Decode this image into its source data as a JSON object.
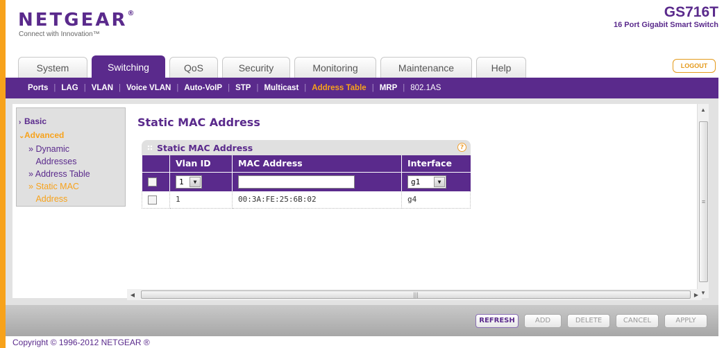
{
  "header": {
    "logo": "NETGEAR",
    "logo_mark": "®",
    "tagline": "Connect with Innovation™",
    "model": "GS716T",
    "model_description": "16 Port Gigabit Smart Switch",
    "logout_label": "LOGOUT"
  },
  "tabs": [
    {
      "label": "System",
      "active": false
    },
    {
      "label": "Switching",
      "active": true
    },
    {
      "label": "QoS",
      "active": false
    },
    {
      "label": "Security",
      "active": false
    },
    {
      "label": "Monitoring",
      "active": false
    },
    {
      "label": "Maintenance",
      "active": false
    },
    {
      "label": "Help",
      "active": false
    }
  ],
  "subnav": [
    {
      "label": "Ports",
      "active": false
    },
    {
      "label": "LAG",
      "active": false
    },
    {
      "label": "VLAN",
      "active": false
    },
    {
      "label": "Voice VLAN",
      "active": false
    },
    {
      "label": "Auto-VoIP",
      "active": false
    },
    {
      "label": "STP",
      "active": false
    },
    {
      "label": "Multicast",
      "active": false
    },
    {
      "label": "Address Table",
      "active": true
    },
    {
      "label": "MRP",
      "active": false
    },
    {
      "label": "802.1AS",
      "active": false
    }
  ],
  "leftnav": {
    "basic": "Basic",
    "advanced": "Advanced",
    "dynamic_addresses": "Dynamic Addresses",
    "address_table": "Address Table",
    "static_mac_address": "Static MAC Address"
  },
  "main": {
    "page_title": "Static MAC Address",
    "panel_title": "Static MAC Address",
    "help_glyph": "?",
    "columns": [
      "Vlan ID",
      "MAC Address",
      "Interface"
    ],
    "input_row": {
      "vlan_id": "1",
      "mac_address": "",
      "interface": "g1"
    },
    "rows": [
      {
        "vlan_id": "1",
        "mac_address": "00:3A:FE:25:6B:02",
        "interface": "g4"
      }
    ]
  },
  "buttons": {
    "refresh": "REFRESH",
    "add": "ADD",
    "delete": "DELETE",
    "cancel": "CANCEL",
    "apply": "APPLY"
  },
  "footer": {
    "copyright": "Copyright © 1996-2012 NETGEAR ®"
  },
  "colors": {
    "brand_purple": "#5a2a8c",
    "accent_orange": "#f7a21b"
  }
}
